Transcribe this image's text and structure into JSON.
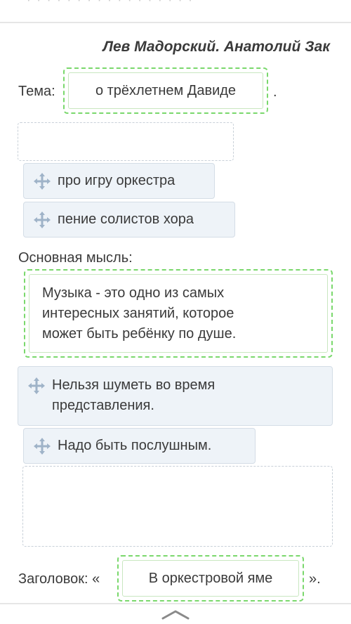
{
  "header": {
    "author": "Лев Мадорский. Анатолий Зак"
  },
  "theme": {
    "label": "Тема:",
    "answer": "о трёхлетнем Давиде",
    "end": "."
  },
  "theme_options": [
    {
      "label": "про игру оркестра",
      "icon": "drag-move-icon"
    },
    {
      "label": "пение солистов хора",
      "icon": "drag-move-icon"
    }
  ],
  "main_idea": {
    "label": "Основная мысль:",
    "answer": "Музыка - это одно из самых интересных занятий, которое может быть ребёнку по душе."
  },
  "main_idea_options": [
    {
      "label": "Нельзя шуметь во время представления.",
      "icon": "drag-move-icon"
    },
    {
      "label": "Надо быть послушным.",
      "icon": "drag-move-icon"
    }
  ],
  "title": {
    "label": "Заголовок: «",
    "answer": "В оркестровой яме",
    "end": "»."
  },
  "colors": {
    "correct_border": "#7ad86c",
    "chip_bg": "#eef3f8",
    "icon": "#9fb3c8"
  }
}
